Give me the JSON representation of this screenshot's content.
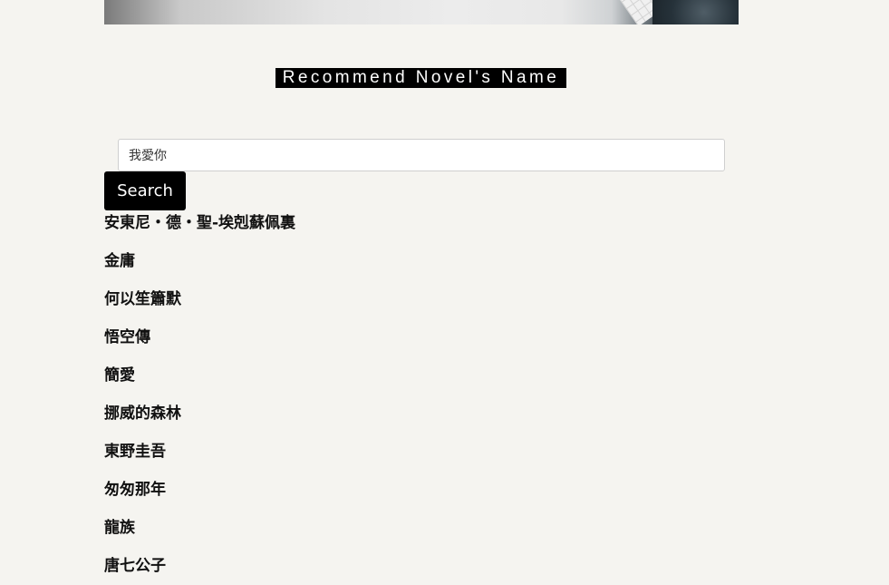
{
  "header": {
    "title": "Recommend Novel's Name"
  },
  "search": {
    "value": "我愛你",
    "button_label": "Search"
  },
  "results": [
    "安東尼・德・聖-埃剋蘇佩裏",
    "金庸",
    "何以笙簫默",
    "悟空傳",
    "簡愛",
    "挪威的森林",
    "東野圭吾",
    "匆匆那年",
    "龍族",
    "唐七公子"
  ]
}
